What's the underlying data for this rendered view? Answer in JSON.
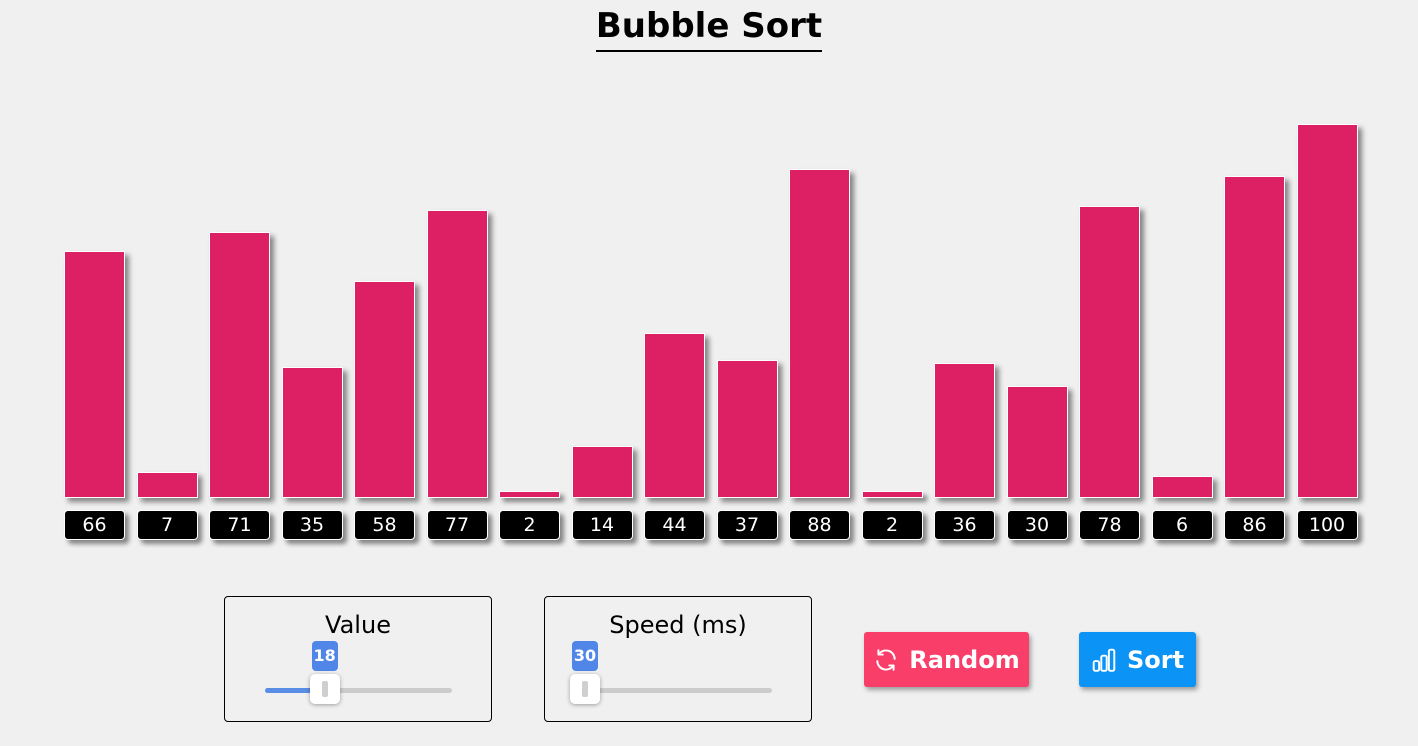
{
  "page": {
    "title": "Bubble Sort"
  },
  "controls": {
    "value_label": "Value",
    "value": 18,
    "value_min": 3,
    "value_max": 50,
    "speed_label": "Speed (ms)",
    "speed": 30,
    "speed_min": 30,
    "speed_max": 1000,
    "random_label": "Random",
    "sort_label": "Sort",
    "random_icon": "refresh-icon",
    "sort_icon": "bar-chart-icon"
  },
  "colors": {
    "bar": "#dc2063",
    "label_bg": "#000000",
    "random_button": "#fa3e6a",
    "sort_button": "#0b93f5",
    "slider_fill": "#5a8ee6",
    "slider_tip": "#4f86e8"
  },
  "chart_data": {
    "type": "bar",
    "title": "",
    "xlabel": "",
    "ylabel": "",
    "ylim": [
      0,
      100
    ],
    "values": [
      66,
      7,
      71,
      35,
      58,
      77,
      2,
      14,
      44,
      37,
      88,
      2,
      36,
      30,
      78,
      6,
      86,
      100
    ]
  }
}
